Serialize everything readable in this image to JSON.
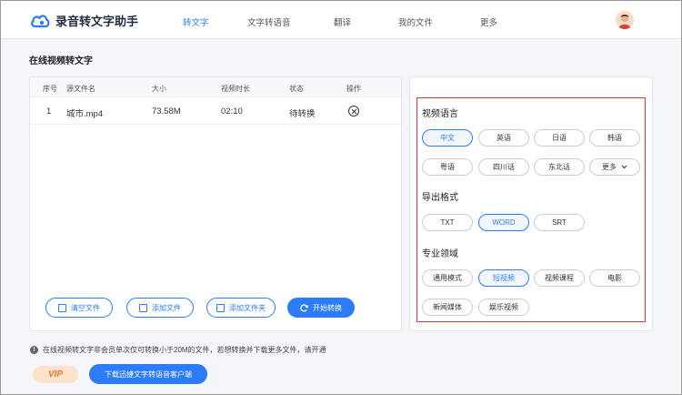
{
  "app": {
    "name": "录音转文字助手"
  },
  "nav": {
    "items": [
      "转文字",
      "文字转语音",
      "翻译",
      "我的文件",
      "更多"
    ],
    "active_index": 0
  },
  "page": {
    "title": "在线视频转文字"
  },
  "table": {
    "headers": [
      "序号",
      "源文件名",
      "大小",
      "视频时长",
      "状态",
      "操作"
    ],
    "rows": [
      {
        "index": "1",
        "name": "城市.mp4",
        "size": "73.58M",
        "duration": "02:10",
        "status": "待转换"
      }
    ]
  },
  "actions": {
    "clear": "清空文件",
    "add_file": "添加文件",
    "add_folder": "添加文件夹",
    "start": "开始转换"
  },
  "settings": {
    "language": {
      "title": "视频语言",
      "options": [
        "中文",
        "英语",
        "日语",
        "韩语",
        "粤语",
        "四川话",
        "东北话"
      ],
      "more": "更多",
      "selected": "中文"
    },
    "format": {
      "title": "导出格式",
      "options": [
        "TXT",
        "WORD",
        "SRT"
      ],
      "selected": "WORD"
    },
    "domain": {
      "title": "专业领域",
      "options": [
        "通用模式",
        "短视频",
        "视频课程",
        "电影",
        "新闻媒体",
        "娱乐视频"
      ],
      "selected": "短视频"
    }
  },
  "footer": {
    "notice": "在线视频转文字非会员单次仅可转换小于20M的文件，若想转换并下载更多文件，请开通",
    "vip": "VIP",
    "download": "下载迅捷文字转语音客户端"
  },
  "colors": {
    "accent": "#2b7cf6",
    "highlight": "#e0303a"
  }
}
